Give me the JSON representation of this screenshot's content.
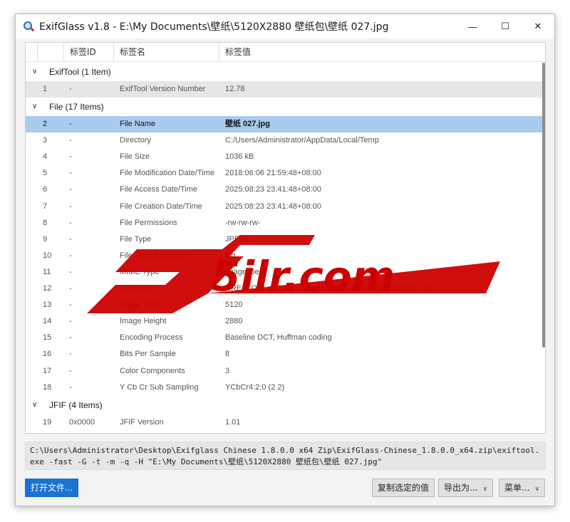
{
  "window": {
    "title": "ExifGlass v1.8 - E:\\My Documents\\壁纸\\5120X2880 壁纸包\\壁纸 027.jpg"
  },
  "controls": {
    "minimize": "—",
    "maximize": "☐",
    "close": "✕"
  },
  "columns": {
    "id": "标签ID",
    "name": "标签名",
    "value": "标签值"
  },
  "groups": [
    {
      "name": "ExifTool (1 Item)",
      "rows": [
        {
          "no": "1",
          "id": "-",
          "name": "ExifTool Version Number",
          "value": "12.78",
          "soft": true
        }
      ]
    },
    {
      "name": "File (17 Items)",
      "rows": [
        {
          "no": "2",
          "id": "-",
          "name": "File Name",
          "value": "壁纸 027.jpg",
          "selected": true
        },
        {
          "no": "3",
          "id": "-",
          "name": "Directory",
          "value": "C:/Users/Administrator/AppData/Local/Temp"
        },
        {
          "no": "4",
          "id": "-",
          "name": "File Size",
          "value": "1036 kB"
        },
        {
          "no": "5",
          "id": "-",
          "name": "File Modification Date/Time",
          "value": "2018:06:06 21:59:48+08:00"
        },
        {
          "no": "6",
          "id": "-",
          "name": "File Access Date/Time",
          "value": "2025:08:23 23:41:48+08:00"
        },
        {
          "no": "7",
          "id": "-",
          "name": "File Creation Date/Time",
          "value": "2025:08:23 23:41:48+08:00"
        },
        {
          "no": "8",
          "id": "-",
          "name": "File Permissions",
          "value": "-rw-rw-rw-"
        },
        {
          "no": "9",
          "id": "-",
          "name": "File Type",
          "value": "JPEG"
        },
        {
          "no": "10",
          "id": "-",
          "name": "File Type Extension",
          "value": "jpg"
        },
        {
          "no": "11",
          "id": "-",
          "name": "MIME Type",
          "value": "image/jpeg"
        },
        {
          "no": "12",
          "id": "-",
          "name": "Comment",
          "value": "CREATOR: gd-jpeg v1.0 (using IJG JPEG v62), quality = 90."
        },
        {
          "no": "13",
          "id": "-",
          "name": "Image Width",
          "value": "5120"
        },
        {
          "no": "14",
          "id": "-",
          "name": "Image Height",
          "value": "2880"
        },
        {
          "no": "15",
          "id": "-",
          "name": "Encoding Process",
          "value": "Baseline DCT, Huffman coding"
        },
        {
          "no": "16",
          "id": "-",
          "name": "Bits Per Sample",
          "value": "8"
        },
        {
          "no": "17",
          "id": "-",
          "name": "Color Components",
          "value": "3"
        },
        {
          "no": "18",
          "id": "-",
          "name": "Y Cb Cr Sub Sampling",
          "value": "YCbCr4:2:0 (2 2)"
        }
      ]
    },
    {
      "name": "JFIF (4 Items)",
      "rows": [
        {
          "no": "19",
          "id": "0x0000",
          "name": "JFIF Version",
          "value": "1.01"
        }
      ]
    }
  ],
  "command": "C:\\Users\\Administrator\\Desktop\\Exifglass Chinese 1.8.0.0 x64 Zip\\ExifGlass-Chinese_1.8.0.0_x64.zip\\exiftool.exe -fast -G -t -m -q -H  \"E:\\My Documents\\壁纸\\5120X2880 壁纸包\\壁纸 027.jpg\"",
  "buttons": {
    "open": "打开文件...",
    "copy": "复制选定的值",
    "export": "导出为...",
    "menu": "菜单..."
  },
  "watermark": {
    "text": "5ilr.com",
    "color": "#cc0000"
  },
  "colors": {
    "selection": "#a9cbee",
    "primary": "#1a73d1"
  }
}
